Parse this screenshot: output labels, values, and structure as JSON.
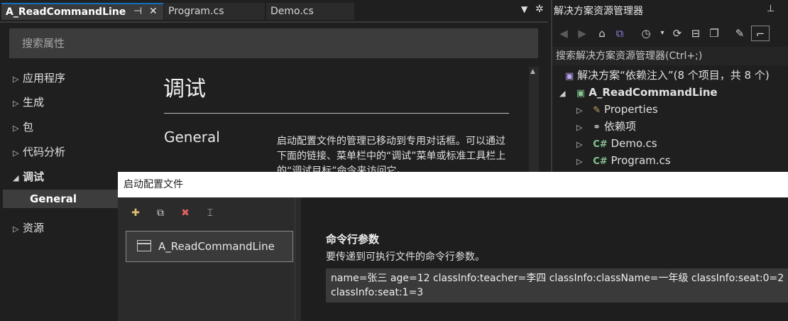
{
  "tabs": [
    {
      "label": "A_ReadCommandLine",
      "active": true
    },
    {
      "label": "Program.cs",
      "active": false
    },
    {
      "label": "Demo.cs",
      "active": false
    }
  ],
  "props": {
    "search_placeholder": "搜索属性",
    "nav": [
      {
        "label": "应用程序",
        "expanded": false
      },
      {
        "label": "生成",
        "expanded": false
      },
      {
        "label": "包",
        "expanded": false
      },
      {
        "label": "代码分析",
        "expanded": false
      },
      {
        "label": "调试",
        "expanded": true,
        "bold": true
      },
      {
        "label": "资源",
        "expanded": false
      }
    ],
    "nav_sub_selected": "General",
    "page_title": "调试",
    "section_title": "General",
    "description": "启动配置文件的管理已移动到专用对话框。可以通过下面的链接、菜单栏中的“调试”菜单或标准工具栏上的“调试目标”命令来访问它。"
  },
  "solution_explorer": {
    "title": "解决方案资源管理器",
    "search_placeholder": "搜索解决方案资源管理器(Ctrl+;)",
    "tree": [
      {
        "label": "解决方案“依赖注入”(8 个项目，共 8 个)",
        "icon": "solution-icon"
      },
      {
        "label": "A_ReadCommandLine",
        "icon": "csharp-project-icon",
        "bold": true
      },
      {
        "label": "Properties",
        "icon": "properties-icon"
      },
      {
        "label": "依赖项",
        "icon": "dependencies-icon"
      },
      {
        "label": "Demo.cs",
        "icon": "csharp-file-icon",
        "prefix": "C#"
      },
      {
        "label": "Program.cs",
        "icon": "csharp-file-icon",
        "prefix": "C#"
      }
    ]
  },
  "dialog": {
    "title": "启动配置文件",
    "profile": "A_ReadCommandLine",
    "args_label": "命令行参数",
    "args_description": "要传递到可执行文件的命令行参数。",
    "args_line1": "name=张三 age=12 classInfo:teacher=李四 classInfo:className=一年级 classInfo:seat:0=2",
    "args_line2": "classInfo:seat:1=3"
  },
  "colors": {
    "accent": "#0e70c0",
    "background": "#1f1f1f",
    "csharp_green": "#86c691"
  }
}
